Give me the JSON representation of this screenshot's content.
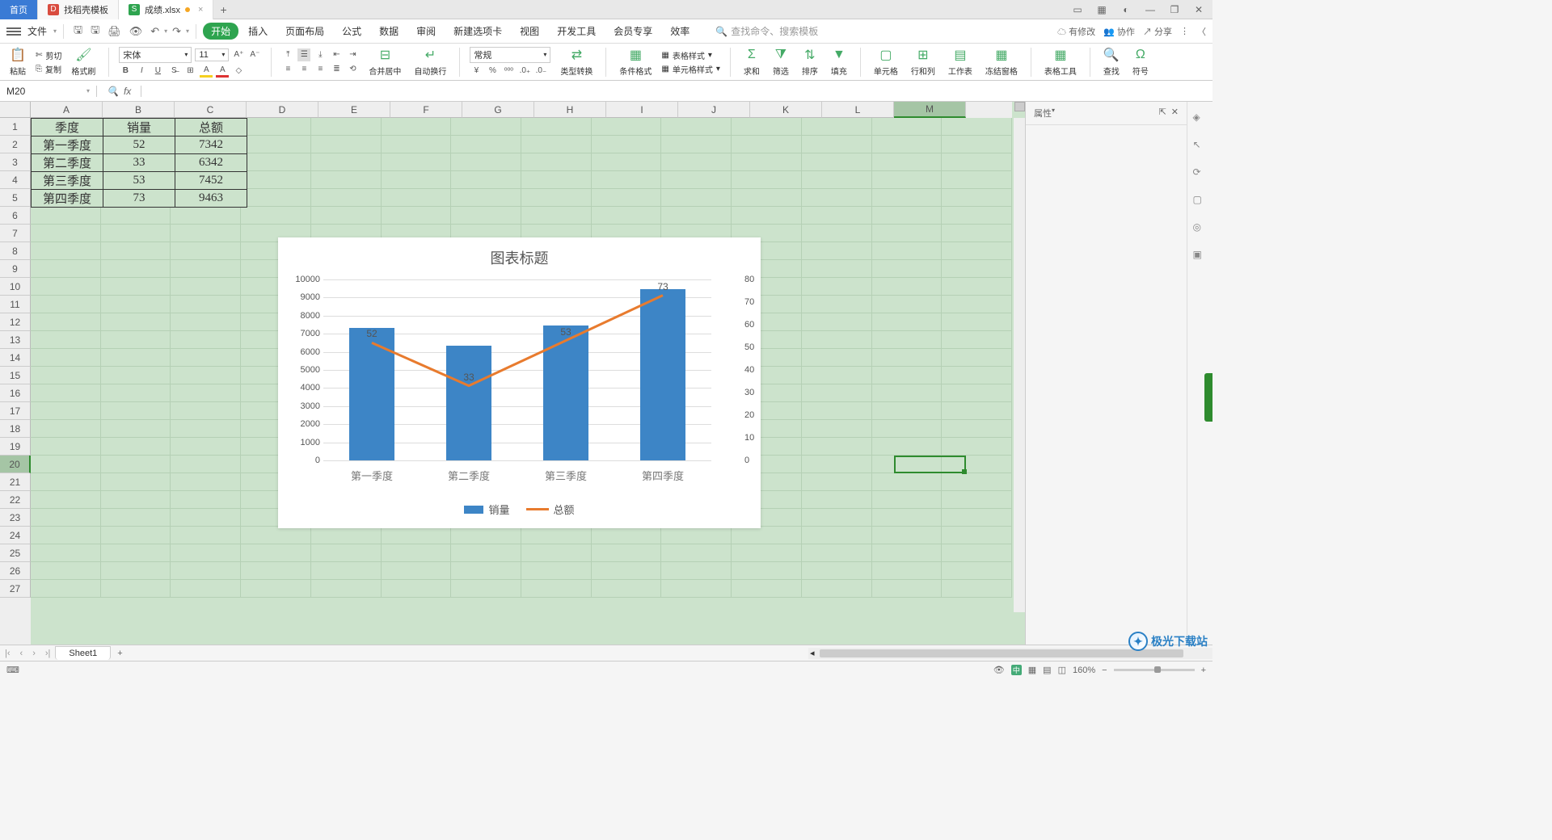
{
  "tabs": {
    "home": "首页",
    "template": "找稻壳模板",
    "file": "成绩.xlsx"
  },
  "menu": {
    "file": "文件",
    "ribbons": [
      "开始",
      "插入",
      "页面布局",
      "公式",
      "数据",
      "审阅",
      "新建选项卡",
      "视图",
      "开发工具",
      "会员专享",
      "效率"
    ],
    "search_label": "查找命令、搜索模板",
    "right": {
      "changes": "有修改",
      "collab": "协作",
      "share": "分享"
    }
  },
  "ribbon": {
    "paste": "粘贴",
    "cut": "剪切",
    "copy": "复制",
    "format_painter": "格式刷",
    "font": "宋体",
    "font_size": "11",
    "merge": "合并居中",
    "wrap": "自动换行",
    "number_format": "常规",
    "type_convert": "类型转换",
    "cond_fmt": "条件格式",
    "cell_style": "单元格样式",
    "table_style": "表格样式",
    "sum": "求和",
    "filter": "筛选",
    "sort": "排序",
    "fill": "填充",
    "cell": "单元格",
    "rowcol": "行和列",
    "sheet": "工作表",
    "freeze": "冻结窗格",
    "table_tools": "表格工具",
    "find": "查找",
    "symbol": "符号"
  },
  "name_box": "M20",
  "columns": [
    "A",
    "B",
    "C",
    "D",
    "E",
    "F",
    "G",
    "H",
    "I",
    "J",
    "K",
    "L",
    "M"
  ],
  "table": {
    "headers": [
      "季度",
      "销量",
      "总额"
    ],
    "rows": [
      [
        "第一季度",
        "52",
        "7342"
      ],
      [
        "第二季度",
        "33",
        "6342"
      ],
      [
        "第三季度",
        "53",
        "7452"
      ],
      [
        "第四季度",
        "73",
        "9463"
      ]
    ]
  },
  "chart_data": {
    "type": "combo",
    "title": "图表标题",
    "categories": [
      "第一季度",
      "第二季度",
      "第三季度",
      "第四季度"
    ],
    "series": [
      {
        "name": "销量",
        "type": "line",
        "axis": "secondary",
        "values": [
          52,
          33,
          53,
          73
        ]
      },
      {
        "name": "总额",
        "type": "bar",
        "axis": "primary",
        "values": [
          7342,
          6342,
          7452,
          9463
        ]
      }
    ],
    "y_axis": {
      "min": 0,
      "max": 10000,
      "step": 1000
    },
    "y_axis2": {
      "min": 0,
      "max": 80,
      "step": 10
    },
    "data_labels": [
      "52",
      "33",
      "53",
      "73"
    ],
    "legend": [
      "销量",
      "总额"
    ]
  },
  "right_panel": {
    "title": "属性"
  },
  "sheet": {
    "name": "Sheet1"
  },
  "status": {
    "zoom": "160%"
  },
  "watermark": "极光下载站"
}
